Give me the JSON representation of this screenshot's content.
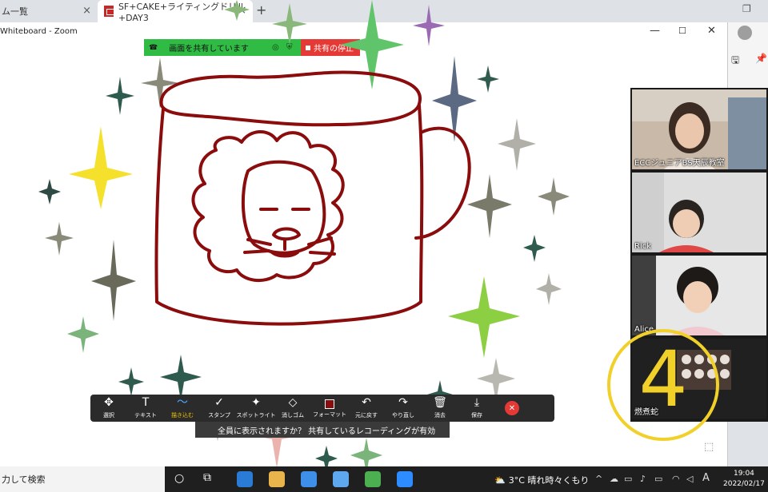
{
  "browser": {
    "tab1_label": "ム一覧",
    "tab2_label": "SF+CAKE+ライティングドリル+DAY3",
    "tab_close": "×",
    "new_tab": "+",
    "side_icons": [
      "🖫",
      "📌"
    ]
  },
  "zoom": {
    "window_title": "Whiteboard - Zoom",
    "min": "—",
    "max": "☐",
    "close": "✕",
    "share_status": "画面を共有しています",
    "stop_share": "共有の停止"
  },
  "participants": [
    {
      "name": "ECCジュニアBS天辰教室"
    },
    {
      "name": "Rick"
    },
    {
      "name": "Alice"
    },
    {
      "name": "燃煮蛇"
    }
  ],
  "overlay_number": "4",
  "toolbar": {
    "tools": [
      {
        "icon": "✥",
        "label": "選択"
      },
      {
        "icon": "T",
        "label": "テキスト"
      },
      {
        "icon": "〜",
        "label": "描き込む",
        "active": true
      },
      {
        "icon": "✓",
        "label": "スタンプ"
      },
      {
        "icon": "✦",
        "label": "スポットライト"
      },
      {
        "icon": "◇",
        "label": "消しゴム"
      },
      {
        "icon": "",
        "label": "フォーマット",
        "color": "#8a0c0c"
      },
      {
        "icon": "↶",
        "label": "元に戻す"
      },
      {
        "icon": "↷",
        "label": "やり直し"
      },
      {
        "icon": "🗑",
        "label": "消去"
      },
      {
        "icon": "⤓",
        "label": "保存"
      }
    ],
    "close": "✕"
  },
  "notice": "全員に表示されますか？ 共有しているレコーディングが有効",
  "taskbar": {
    "search": "力して検索",
    "weather": "3°C 晴れ時々くもり",
    "time": "19:04",
    "date": "2022/02/17",
    "ime": "A"
  },
  "colors": {
    "ink": "#8a0c0c",
    "share_green": "#2fbb44",
    "stop_red": "#e53935",
    "overlay_yellow": "#f2d02a"
  }
}
